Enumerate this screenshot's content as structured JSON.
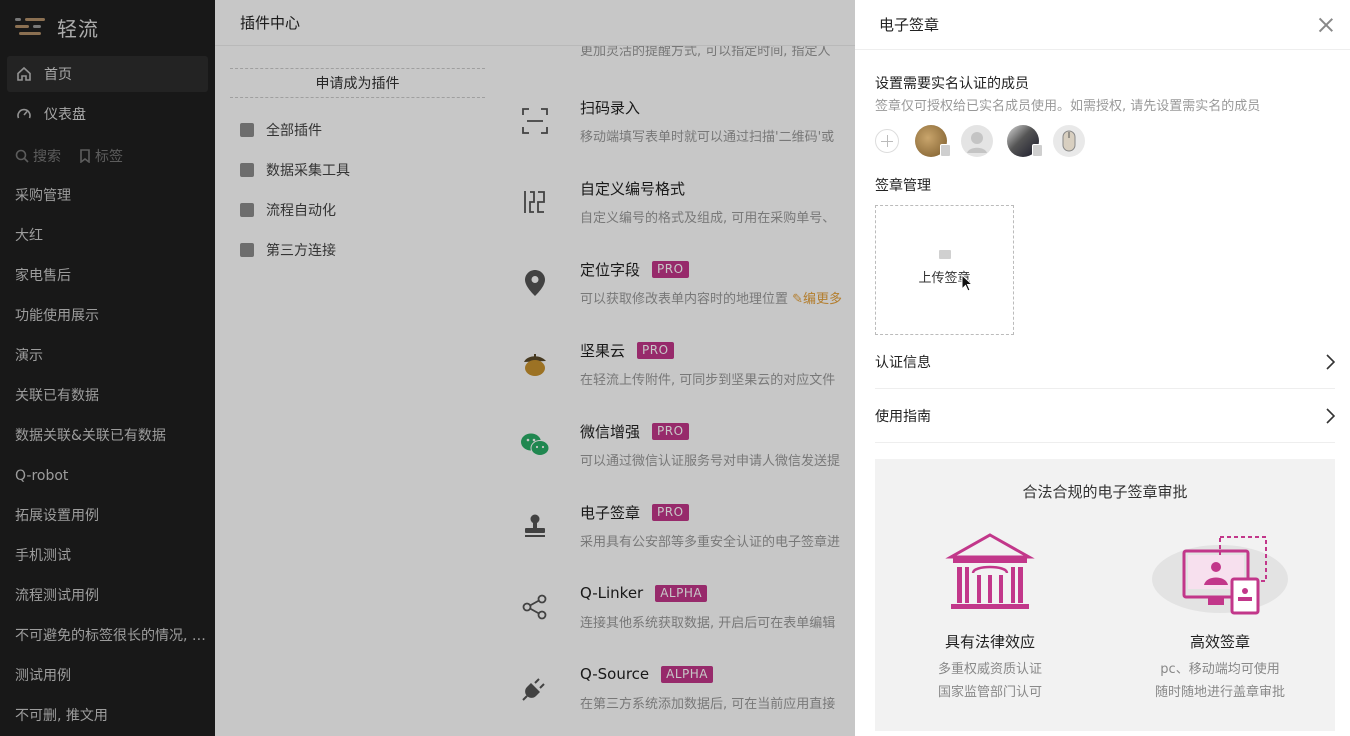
{
  "sidebar": {
    "logo_text": "轻流",
    "nav": [
      {
        "label": "首页",
        "icon": "home-icon",
        "active": true
      },
      {
        "label": "仪表盘",
        "icon": "dashboard-icon",
        "active": false
      }
    ],
    "search_label": "搜索",
    "tag_label": "标签",
    "apps": [
      "采购管理",
      "大红",
      "家电售后",
      "功能使用展示",
      "演示",
      "关联已有数据",
      "数据关联&关联已有数据",
      "Q-robot",
      "拓展设置用例",
      "手机测试",
      "流程测试用例",
      "不可避免的标签很长的情况, 需要截断显示",
      "测试用例",
      "不可删, 推文用"
    ]
  },
  "main": {
    "header_title": "插件中心",
    "apply_label": "申请成为插件",
    "categories": [
      "全部插件",
      "数据采集工具",
      "流程自动化",
      "第三方连接"
    ],
    "top_cut_text": "更加灵活的提醒方式, 可以指定时间, 指定人",
    "plugins": [
      {
        "title": "扫码录入",
        "badge": "",
        "desc": "移动端填写表单时就可以通过扫描'二维码'或",
        "icon": "scan-icon"
      },
      {
        "title": "自定义编号格式",
        "badge": "",
        "desc": "自定义编号的格式及组成, 可用在采购单号、",
        "icon": "serial-number-icon"
      },
      {
        "title": "定位字段",
        "badge": "PRO",
        "desc": "可以获取修改表单内容时的地理位置",
        "desc_link": "✎编更多",
        "icon": "location-pin-icon"
      },
      {
        "title": "坚果云",
        "badge": "PRO",
        "desc": "在轻流上传附件, 可同步到坚果云的对应文件",
        "icon": "nut-cloud-icon"
      },
      {
        "title": "微信增强",
        "badge": "PRO",
        "desc": "可以通过微信认证服务号对申请人微信发送提",
        "icon": "wechat-icon"
      },
      {
        "title": "电子签章",
        "badge": "PRO",
        "desc": "采用具有公安部等多重安全认证的电子签章进",
        "icon": "stamp-icon"
      },
      {
        "title": "Q-Linker",
        "badge": "ALPHA",
        "desc": "连接其他系统获取数据, 开启后可在表单编辑",
        "icon": "share-nodes-icon"
      },
      {
        "title": "Q-Source",
        "badge": "ALPHA",
        "desc": "在第三方系统添加数据后, 可在当前应用直接",
        "icon": "plug-icon"
      }
    ]
  },
  "drawer": {
    "title": "电子签章",
    "members_title": "设置需要实名认证的成员",
    "members_desc": "签章仅可授权给已实名成员使用。如需授权, 请先设置需实名的成员",
    "seal_title": "签章管理",
    "upload_label": "上传签章",
    "links": [
      {
        "label": "认证信息"
      },
      {
        "label": "使用指南"
      }
    ],
    "promo": {
      "title": "合法合规的电子签章审批",
      "features": [
        {
          "title": "具有法律效应",
          "lines": [
            "多重权威资质认证",
            "国家监管部门认可"
          ],
          "icon": "courthouse-icon"
        },
        {
          "title": "高效签章",
          "lines": [
            "pc、移动端均可使用",
            "随时随地进行盖章审批"
          ],
          "icon": "devices-icon"
        }
      ]
    }
  },
  "colors": {
    "sidebar_bg": "#1f1f1f",
    "badge": "#c2378a",
    "promo_accent": "#c2378a"
  }
}
